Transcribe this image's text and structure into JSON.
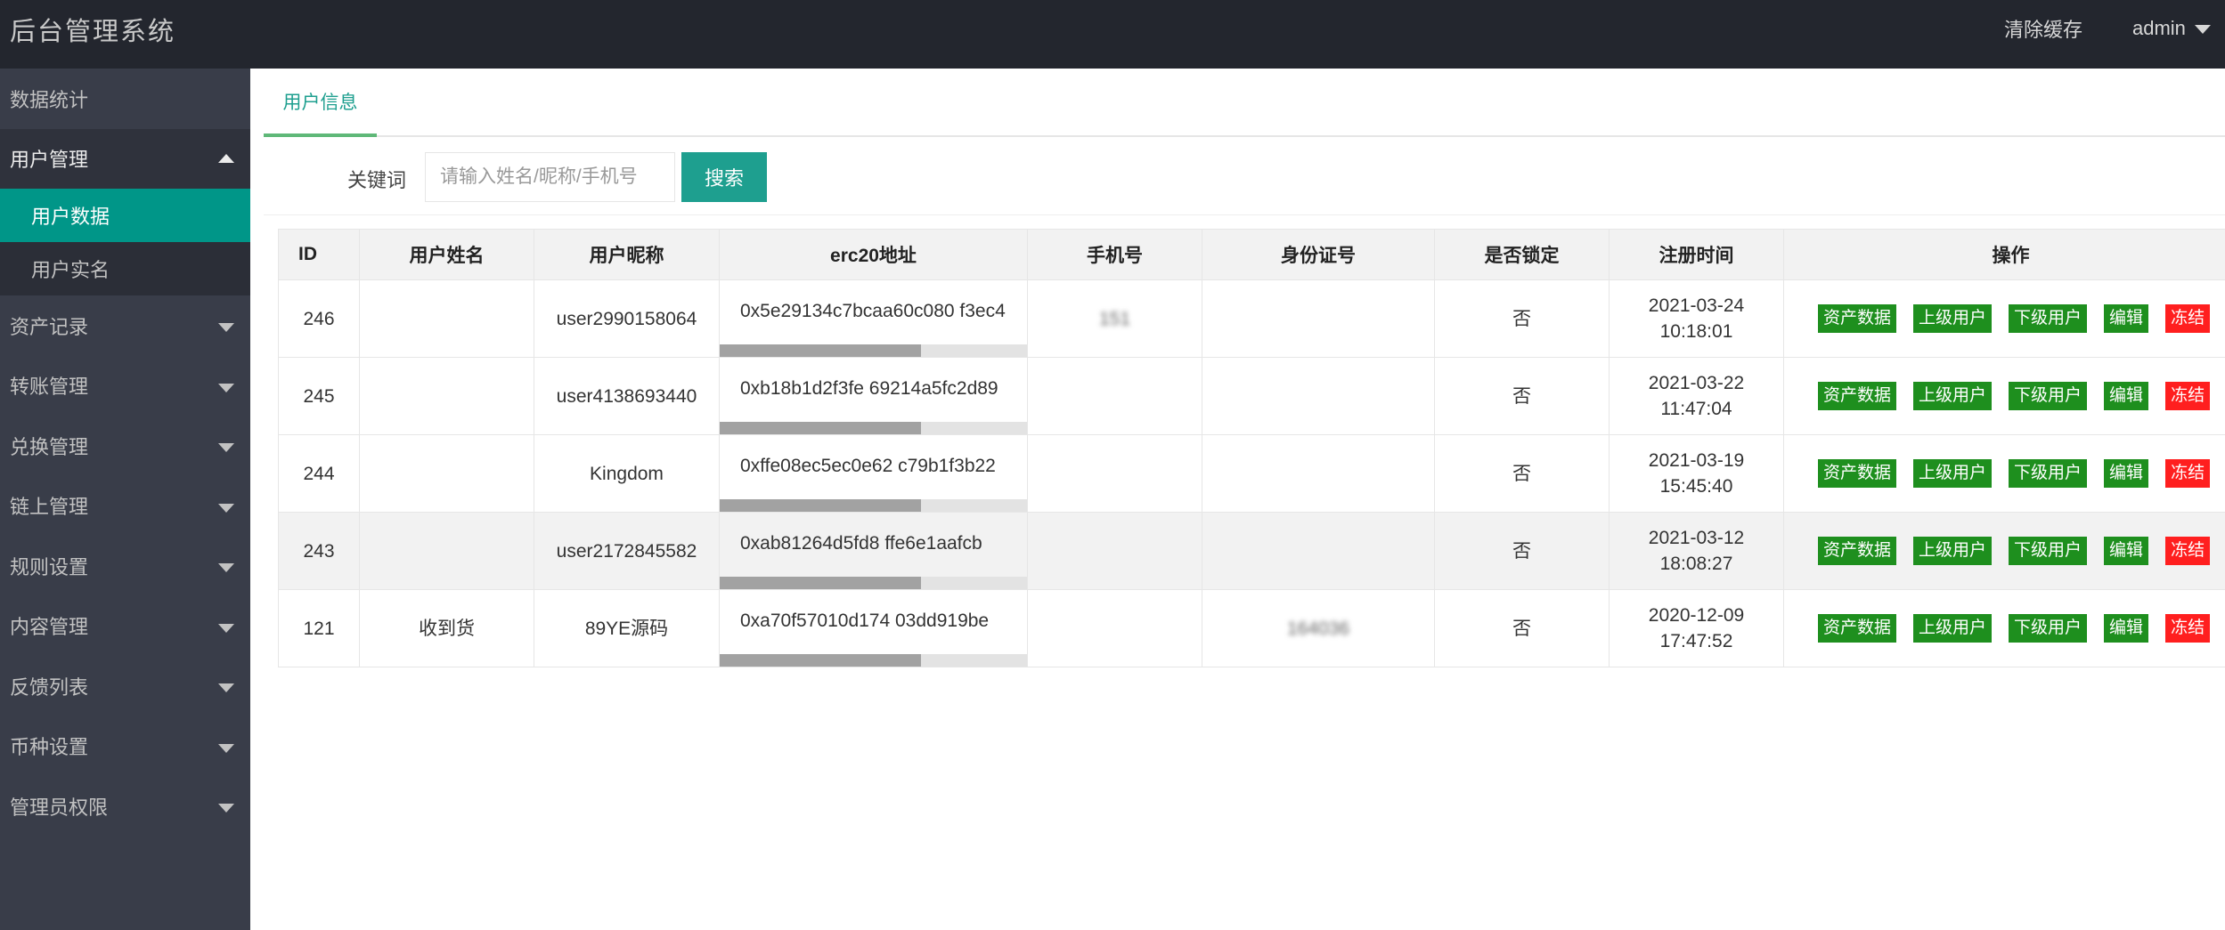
{
  "app": {
    "title": "后台管理系统"
  },
  "header": {
    "clear_cache": "清除缓存",
    "user": "admin"
  },
  "sidebar": {
    "items": [
      {
        "label": "数据统计"
      },
      {
        "label": "用户管理",
        "sub": [
          {
            "label": "用户数据"
          },
          {
            "label": "用户实名"
          }
        ]
      },
      {
        "label": "资产记录"
      },
      {
        "label": "转账管理"
      },
      {
        "label": "兑换管理"
      },
      {
        "label": "链上管理"
      },
      {
        "label": "规则设置"
      },
      {
        "label": "内容管理"
      },
      {
        "label": "反馈列表"
      },
      {
        "label": "币种设置"
      },
      {
        "label": "管理员权限"
      }
    ]
  },
  "tab": {
    "label": "用户信息"
  },
  "search": {
    "label": "关键词",
    "placeholder": "请输入姓名/昵称/手机号",
    "button": "搜索"
  },
  "table": {
    "headers": [
      "ID",
      "用户姓名",
      "用户昵称",
      "erc20地址",
      "手机号",
      "身份证号",
      "是否锁定",
      "注册时间",
      "操作"
    ],
    "rows": [
      {
        "id": "246",
        "name": "",
        "nickname": "user2990158064",
        "address": "0x5e29134c7bcaa60c080 f3ec4",
        "phone": "151",
        "idcard": "",
        "locked": "否",
        "date": "2021-03-24",
        "time": "10:18:01"
      },
      {
        "id": "245",
        "name": "",
        "nickname": "user4138693440",
        "address": "0xb18b1d2f3fe 69214a5fc2d89",
        "phone": "",
        "idcard": "",
        "locked": "否",
        "date": "2021-03-22",
        "time": "11:47:04"
      },
      {
        "id": "244",
        "name": "",
        "nickname": "Kingdom",
        "address": "0xffe08ec5ec0e62 c79b1f3b22",
        "phone": "",
        "idcard": "",
        "locked": "否",
        "date": "2021-03-19",
        "time": "15:45:40"
      },
      {
        "id": "243",
        "name": "",
        "nickname": "user2172845582",
        "address": "0xab81264d5fd8 ffe6e1aafcb",
        "phone": "",
        "idcard": "",
        "locked": "否",
        "date": "2021-03-12",
        "time": "18:08:27"
      },
      {
        "id": "121",
        "name": "收到货",
        "nickname": "89YE源码",
        "address": "0xa70f57010d174 03dd919be",
        "phone": "",
        "idcard": "164036",
        "locked": "否",
        "date": "2020-12-09",
        "time": "17:47:52"
      }
    ],
    "actions": {
      "assets": "资产数据",
      "upper": "上级用户",
      "lower": "下级用户",
      "edit": "编辑",
      "freeze": "冻结"
    }
  },
  "colors": {
    "header_bg": "#23262e",
    "sidebar_bg": "#393d49",
    "accent": "#009688",
    "btn_green": "#1e8f1e",
    "btn_red": "#ff1f1f"
  }
}
